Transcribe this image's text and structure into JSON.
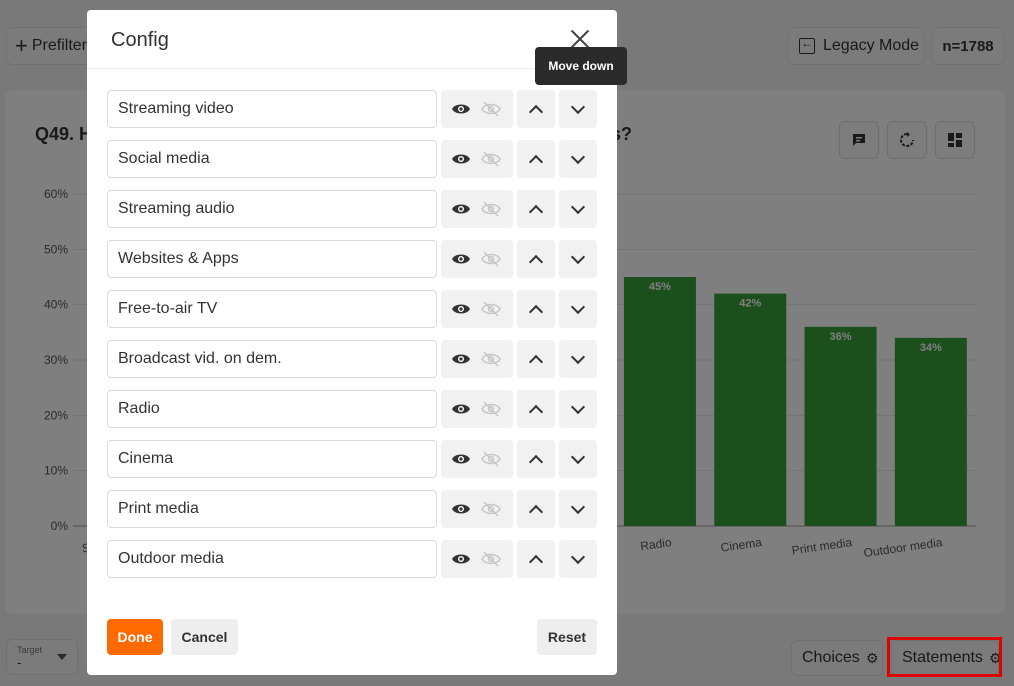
{
  "app": {
    "prefilter_label": "Prefilter",
    "legacy_label": "Legacy Mode",
    "n_count": "n=1788",
    "question_title_start": "Q49. H",
    "question_title_end": "s?",
    "target_label": "Target",
    "target_value": "-",
    "choices_label": "Choices",
    "statements_label": "Statements"
  },
  "chart_data": {
    "type": "bar",
    "categories": [
      "Streaming video",
      "Social media",
      "Streaming audio",
      "Websites & Apps",
      "Free-to-air TV",
      "Broadcast vid. on dem.",
      "Radio",
      "Cinema",
      "Print media",
      "Outdoor media"
    ],
    "visible_x_labels": [
      "Streamin",
      "Radio",
      "Cinema",
      "Print media",
      "Outdoor media"
    ],
    "visible_values": [
      {
        "category": "Radio",
        "value": 45,
        "label": "45%"
      },
      {
        "category": "Cinema",
        "value": 42,
        "label": "42%"
      },
      {
        "category": "Print media",
        "value": 36,
        "label": "36%"
      },
      {
        "category": "Outdoor media",
        "value": 34,
        "label": "34%"
      }
    ],
    "yticks": [
      "0%",
      "10%",
      "20%",
      "30%",
      "40%",
      "50%",
      "60%"
    ],
    "ylim": [
      0,
      60
    ],
    "bar_color": "#36a03a"
  },
  "modal": {
    "title": "Config",
    "tooltip": "Move down",
    "items": [
      {
        "label": "Streaming video"
      },
      {
        "label": "Social media"
      },
      {
        "label": "Streaming audio"
      },
      {
        "label": "Websites & Apps"
      },
      {
        "label": "Free-to-air TV"
      },
      {
        "label": "Broadcast vid. on dem."
      },
      {
        "label": "Radio"
      },
      {
        "label": "Cinema"
      },
      {
        "label": "Print media"
      },
      {
        "label": "Outdoor media"
      }
    ],
    "done_label": "Done",
    "cancel_label": "Cancel",
    "reset_label": "Reset"
  },
  "colors": {
    "accent": "#ff6a00",
    "highlight": "#e00000"
  }
}
